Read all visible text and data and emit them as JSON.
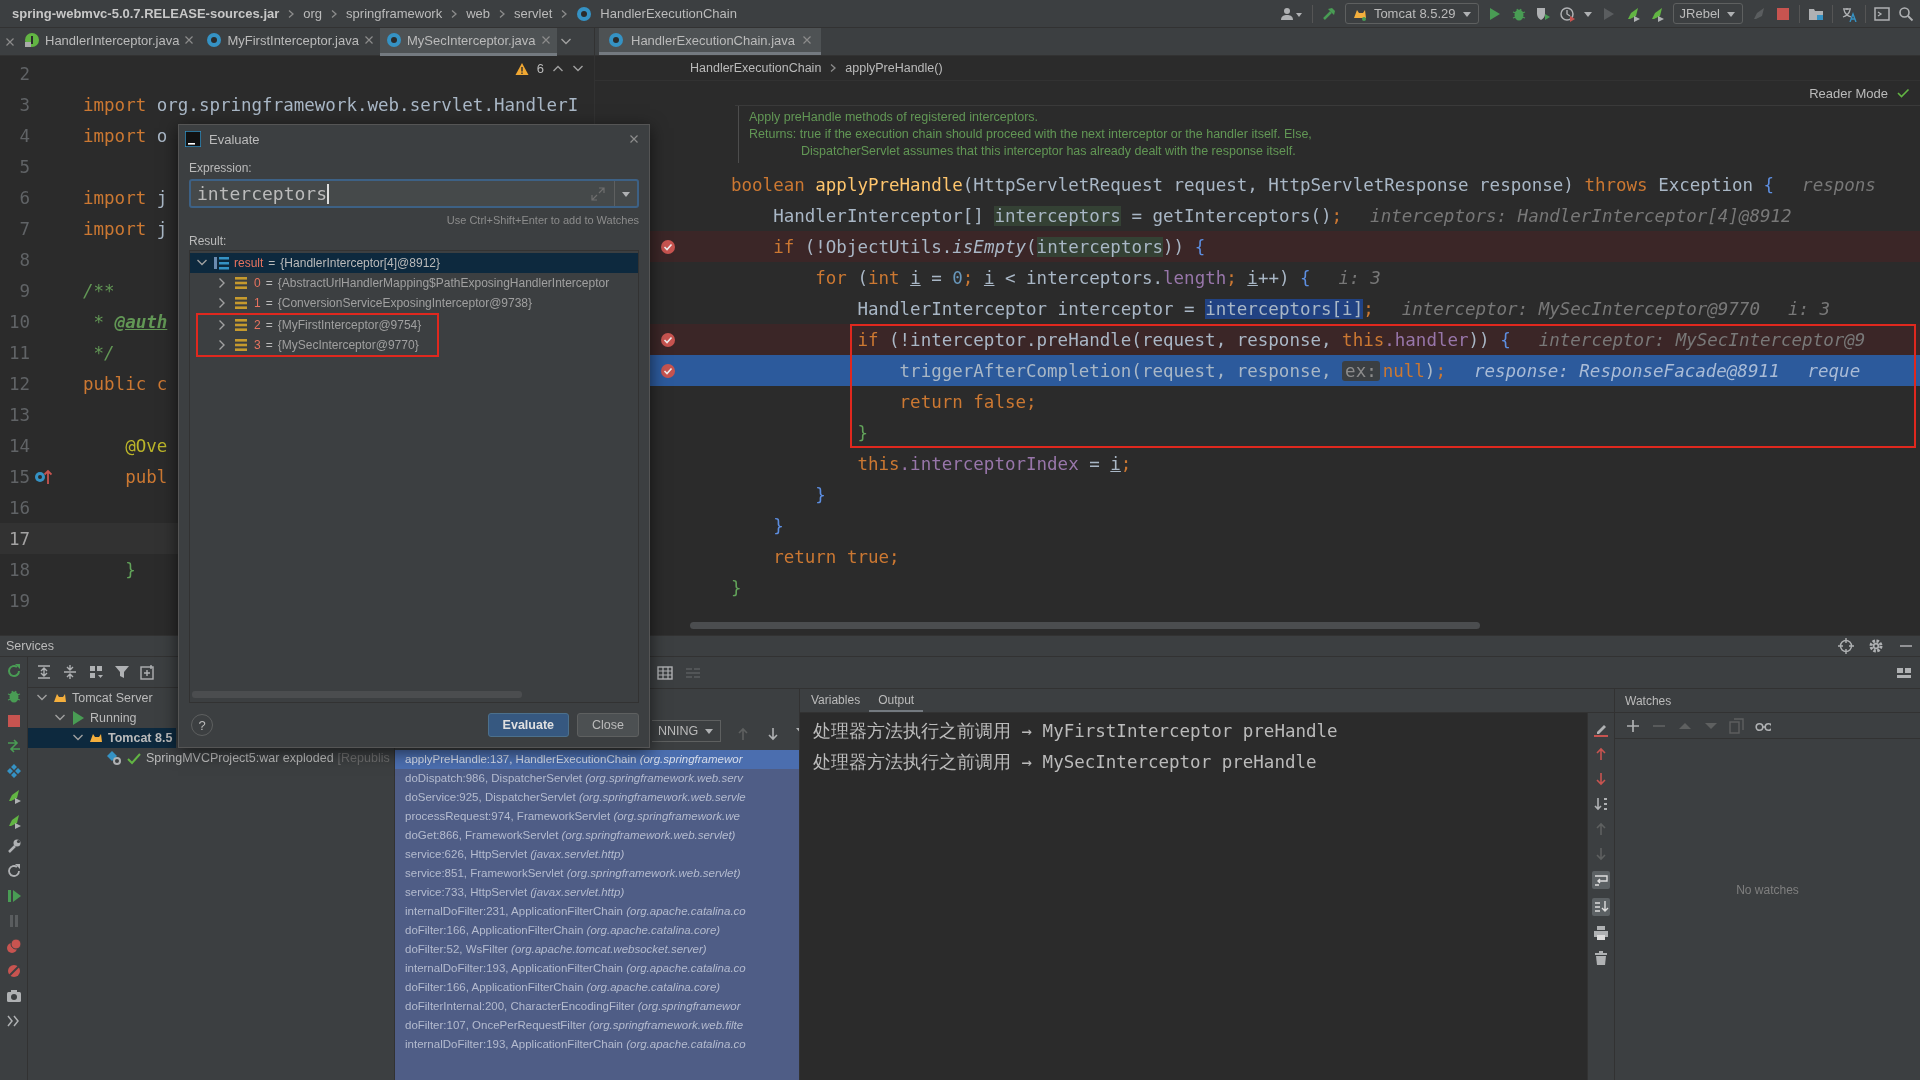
{
  "navbar": {
    "crumbs": [
      {
        "text": "spring-webmvc-5.0.7.RELEASE-sources.jar",
        "kind": "jar"
      },
      {
        "text": "org",
        "kind": "package"
      },
      {
        "text": "springframework",
        "kind": "package"
      },
      {
        "text": "web",
        "kind": "package"
      },
      {
        "text": "servlet",
        "kind": "package"
      },
      {
        "text": "HandlerExecutionChain",
        "kind": "class"
      }
    ],
    "run_config": "Tomcat 8.5.29",
    "plugin": "JRebel"
  },
  "left_editor": {
    "tabs": [
      {
        "label": "HandlerInterceptor.java",
        "kind": "interface",
        "selected": false
      },
      {
        "label": "MyFirstInterceptor.java",
        "kind": "class",
        "selected": false
      },
      {
        "label": "MySecInterceptor.java",
        "kind": "class",
        "selected": true
      }
    ],
    "warnings": "6",
    "lines": [
      {
        "number": "2",
        "kind": "plain",
        "current": false
      },
      {
        "number": "3",
        "kind": "plain",
        "current": false,
        "tokens": [
          {
            "kind": "kw",
            "text": "import "
          },
          {
            "kind": "plain",
            "text": "org.springframework.web.servlet.HandlerI"
          }
        ]
      },
      {
        "number": "4",
        "kind": "plain",
        "current": false,
        "tokens": [
          {
            "kind": "kw",
            "text": "import "
          },
          {
            "kind": "plain",
            "text": "o"
          }
        ]
      },
      {
        "number": "5",
        "kind": "plain",
        "current": false
      },
      {
        "number": "6",
        "kind": "plain",
        "current": false,
        "tokens": [
          {
            "kind": "kw",
            "text": "import "
          },
          {
            "kind": "plain",
            "text": "j"
          }
        ]
      },
      {
        "number": "7",
        "kind": "plain",
        "current": false,
        "tokens": [
          {
            "kind": "kw",
            "text": "import "
          },
          {
            "kind": "plain",
            "text": "j"
          }
        ]
      },
      {
        "number": "8",
        "kind": "plain",
        "current": false
      },
      {
        "number": "9",
        "kind": "plain",
        "current": false,
        "tokens": [
          {
            "kind": "comment",
            "text": "/**"
          }
        ]
      },
      {
        "number": "10",
        "kind": "plain",
        "current": false,
        "tokens": [
          {
            "kind": "comment",
            "text": " * "
          },
          {
            "kind": "doctag",
            "text": "@auth"
          }
        ]
      },
      {
        "number": "11",
        "kind": "plain",
        "current": false,
        "tokens": [
          {
            "kind": "comment",
            "text": " */"
          }
        ]
      },
      {
        "number": "12",
        "kind": "plain",
        "current": false,
        "tokens": [
          {
            "kind": "kw",
            "text": "public c"
          }
        ]
      },
      {
        "number": "13",
        "kind": "plain",
        "current": false
      },
      {
        "number": "14",
        "kind": "plain",
        "current": false,
        "tokens": [
          {
            "kind": "annot",
            "text": "    @Ove"
          }
        ]
      },
      {
        "number": "15",
        "kind": "override",
        "current": false,
        "tokens": [
          {
            "kind": "kw",
            "text": "    publ"
          }
        ]
      },
      {
        "number": "16",
        "kind": "plain",
        "current": false
      },
      {
        "number": "17",
        "kind": "plain",
        "current": true
      },
      {
        "number": "18",
        "kind": "plain",
        "current": false,
        "tokens": [
          {
            "kind": "brace2",
            "text": "    }"
          }
        ]
      },
      {
        "number": "19",
        "kind": "plain",
        "current": false
      }
    ]
  },
  "right_editor": {
    "tabs": [
      {
        "label": "HandlerExecutionChain.java",
        "kind": "class",
        "selected": true
      }
    ],
    "breadcrumb": [
      "HandlerExecutionChain",
      "applyPreHandle()"
    ],
    "reader_mode": "Reader Mode",
    "doc": [
      {
        "kind": "summary",
        "text": "Apply preHandle methods of registered interceptors."
      },
      {
        "kind": "returns",
        "text": "Returns: true if the execution chain should proceed with the next interceptor or the handler itself. Else,"
      },
      {
        "kind": "continuation",
        "text": "DispatcherServlet assumes that this interceptor has already dealt with the response itself."
      }
    ],
    "lines": [
      {
        "breakpoint": false,
        "current": false,
        "boxed": false,
        "hints": [
          "respons"
        ],
        "tokens": [
          {
            "kind": "kw",
            "text": "boolean "
          },
          {
            "kind": "fn",
            "text": "applyPreHandle"
          },
          {
            "kind": "plain",
            "text": "(HttpServletRequest request, HttpServletResponse response) "
          },
          {
            "kind": "kw",
            "text": "throws "
          },
          {
            "kind": "plain",
            "text": "Exception "
          },
          {
            "kind": "brace",
            "text": "{"
          }
        ]
      },
      {
        "breakpoint": false,
        "current": false,
        "boxed": false,
        "hints": [
          "interceptors: HandlerInterceptor[4]@8912"
        ],
        "tokens": [
          {
            "kind": "plain",
            "text": "    HandlerInterceptor[] "
          },
          {
            "kind": "usage",
            "text": "interceptors"
          },
          {
            "kind": "plain",
            "text": " = getInterceptors()"
          },
          {
            "kind": "kw",
            "text": ";"
          }
        ]
      },
      {
        "breakpoint": true,
        "current": false,
        "boxed": false,
        "tokens": [
          {
            "kind": "kw",
            "text": "    if "
          },
          {
            "kind": "plain",
            "text": "(!ObjectUtils."
          },
          {
            "kind": "static",
            "text": "isEmpty"
          },
          {
            "kind": "plain",
            "text": "("
          },
          {
            "kind": "usage",
            "text": "interceptors"
          },
          {
            "kind": "plain",
            "text": ")) "
          },
          {
            "kind": "brace",
            "text": "{"
          }
        ]
      },
      {
        "breakpoint": false,
        "current": false,
        "boxed": false,
        "hints": [
          "i: 3"
        ],
        "tokens": [
          {
            "kind": "kw",
            "text": "        for "
          },
          {
            "kind": "plain",
            "text": "("
          },
          {
            "kind": "kw",
            "text": "int "
          },
          {
            "kind": "var",
            "text": "i"
          },
          {
            "kind": "plain",
            "text": " = "
          },
          {
            "kind": "num",
            "text": "0"
          },
          {
            "kind": "kw",
            "text": "; "
          },
          {
            "kind": "var",
            "text": "i"
          },
          {
            "kind": "plain",
            "text": " < interceptors."
          },
          {
            "kind": "field",
            "text": "length"
          },
          {
            "kind": "kw",
            "text": "; "
          },
          {
            "kind": "var",
            "text": "i"
          },
          {
            "kind": "plain",
            "text": "++) "
          },
          {
            "kind": "brace",
            "text": "{"
          }
        ]
      },
      {
        "breakpoint": false,
        "current": false,
        "boxed": false,
        "hints": [
          "interceptor: MySecInterceptor@9770",
          "i: 3"
        ],
        "tokens": [
          {
            "kind": "plain",
            "text": "            HandlerInterceptor interceptor = "
          },
          {
            "kind": "sel",
            "text": "interceptors[i]"
          },
          {
            "kind": "kw",
            "text": ";"
          }
        ]
      },
      {
        "breakpoint": true,
        "current": false,
        "boxed": true,
        "hints": [
          "interceptor: MySecInterceptor@9"
        ],
        "tokens": [
          {
            "kind": "kw",
            "text": "            if "
          },
          {
            "kind": "plain",
            "text": "(!interceptor.preHandle(request, response, "
          },
          {
            "kind": "kw",
            "text": "this"
          },
          {
            "kind": "field",
            "text": ".handler"
          },
          {
            "kind": "plain",
            "text": ")) "
          },
          {
            "kind": "brace",
            "text": "{"
          }
        ]
      },
      {
        "breakpoint": true,
        "current": true,
        "boxed": true,
        "hints": [
          "response: ResponseFacade@8911",
          "reque"
        ],
        "tokens": [
          {
            "kind": "plain",
            "text": "                triggerAfterCompletion(request, response, "
          },
          {
            "kind": "param",
            "text": "ex:"
          },
          {
            "kind": "kw",
            "text": "null"
          },
          {
            "kind": "plain",
            "text": ")"
          },
          {
            "kind": "kw",
            "text": ";"
          }
        ]
      },
      {
        "breakpoint": false,
        "current": false,
        "boxed": true,
        "tokens": [
          {
            "kind": "kw",
            "text": "                return false;"
          }
        ]
      },
      {
        "breakpoint": false,
        "current": false,
        "boxed": true,
        "tokens": [
          {
            "kind": "brace2",
            "text": "            }"
          }
        ]
      },
      {
        "breakpoint": false,
        "current": false,
        "boxed": false,
        "tokens": [
          {
            "kind": "kw",
            "text": "            this"
          },
          {
            "kind": "field",
            "text": ".interceptorIndex"
          },
          {
            "kind": "plain",
            "text": " = "
          },
          {
            "kind": "var",
            "text": "i"
          },
          {
            "kind": "kw",
            "text": ";"
          }
        ]
      },
      {
        "breakpoint": false,
        "current": false,
        "boxed": false,
        "tokens": [
          {
            "kind": "brace",
            "text": "        }"
          }
        ]
      },
      {
        "breakpoint": false,
        "current": false,
        "boxed": false,
        "tokens": [
          {
            "kind": "brace",
            "text": "    }"
          }
        ]
      },
      {
        "breakpoint": false,
        "current": false,
        "boxed": false,
        "tokens": [
          {
            "kind": "kw",
            "text": "    return true;"
          }
        ]
      },
      {
        "breakpoint": false,
        "current": false,
        "boxed": false,
        "tokens": [
          {
            "kind": "brace2",
            "text": "}"
          }
        ]
      }
    ]
  },
  "evaluate_dialog": {
    "title": "Evaluate",
    "expression_label": "Expression:",
    "expression": "interceptors",
    "hint": "Use Ctrl+Shift+Enter to add to Watches",
    "result_label": "Result:",
    "result": {
      "name": "result",
      "operator": "=",
      "value": "{HandlerInterceptor[4]@8912}",
      "kind": "array",
      "expanded": true,
      "selected": true,
      "boxed": false,
      "children": [
        {
          "name": "0",
          "operator": "=",
          "value": "{AbstractUrlHandlerMapping$PathExposingHandlerInterceptor",
          "kind": "object",
          "expanded": false,
          "selected": false,
          "boxed": false
        },
        {
          "name": "1",
          "operator": "=",
          "value": "{ConversionServiceExposingInterceptor@9738}",
          "kind": "object",
          "expanded": false,
          "selected": false,
          "boxed": false
        },
        {
          "name": "2",
          "operator": "=",
          "value": "{MyFirstInterceptor@9754}",
          "kind": "object",
          "expanded": false,
          "selected": false,
          "boxed": true
        },
        {
          "name": "3",
          "operator": "=",
          "value": "{MySecInterceptor@9770}",
          "kind": "object",
          "expanded": false,
          "selected": false,
          "boxed": true
        }
      ]
    },
    "help": "?",
    "buttons": [
      {
        "label": "Evaluate",
        "kind": "default"
      },
      {
        "label": "Close",
        "kind": "normal"
      }
    ]
  },
  "services": {
    "title": "Services",
    "tree": [
      {
        "label": "Tomcat Server",
        "kind": "server",
        "expanded": true,
        "selected": false,
        "children": [
          {
            "label": "Running",
            "kind": "running",
            "expanded": true,
            "selected": false,
            "children": [
              {
                "label": "Tomcat 8.5",
                "kind": "tomcat",
                "expanded": true,
                "selected": true,
                "children": [
                  {
                    "label": "SpringMVCProject5:war exploded",
                    "status": "[Republis",
                    "kind": "artifact",
                    "selected": false
                  }
                ]
              }
            ]
          }
        ]
      }
    ]
  },
  "debugger": {
    "thread": "NNING",
    "frames": [
      {
        "method": "applyPreHandle:137, HandlerExecutionChain",
        "package": "(org.springframewor",
        "selected": true
      },
      {
        "method": "doDispatch:986, DispatcherServlet",
        "package": "(org.springframework.web.serv",
        "selected": false
      },
      {
        "method": "doService:925, DispatcherServlet",
        "package": "(org.springframework.web.servle",
        "selected": false
      },
      {
        "method": "processRequest:974, FrameworkServlet",
        "package": "(org.springframework.we",
        "selected": false
      },
      {
        "method": "doGet:866, FrameworkServlet",
        "package": "(org.springframework.web.servlet)",
        "selected": false
      },
      {
        "method": "service:626, HttpServlet",
        "package": "(javax.servlet.http)",
        "selected": false
      },
      {
        "method": "service:851, FrameworkServlet",
        "package": "(org.springframework.web.servlet)",
        "selected": false
      },
      {
        "method": "service:733, HttpServlet",
        "package": "(javax.servlet.http)",
        "selected": false
      },
      {
        "method": "internalDoFilter:231, ApplicationFilterChain",
        "package": "(org.apache.catalina.co",
        "selected": false
      },
      {
        "method": "doFilter:166, ApplicationFilterChain",
        "package": "(org.apache.catalina.core)",
        "selected": false
      },
      {
        "method": "doFilter:52, WsFilter",
        "package": "(org.apache.tomcat.websocket.server)",
        "selected": false
      },
      {
        "method": "internalDoFilter:193, ApplicationFilterChain",
        "package": "(org.apache.catalina.co",
        "selected": false
      },
      {
        "method": "doFilter:166, ApplicationFilterChain",
        "package": "(org.apache.catalina.core)",
        "selected": false
      },
      {
        "method": "doFilterInternal:200, CharacterEncodingFilter",
        "package": "(org.springframewor",
        "selected": false
      },
      {
        "method": "doFilter:107, OncePerRequestFilter",
        "package": "(org.springframework.web.filte",
        "selected": false
      },
      {
        "method": "internalDoFilter:193, ApplicationFilterChain",
        "package": "(org.apache.catalina.co",
        "selected": false
      }
    ],
    "tabs": [
      {
        "label": "Variables",
        "selected": false
      },
      {
        "label": "Output",
        "selected": true
      }
    ],
    "output": [
      "处理器方法执行之前调用 → MyFirstInterceptor preHandle",
      "处理器方法执行之前调用 → MySecInterceptor preHandle"
    ],
    "watches": {
      "title": "Watches",
      "empty": "No watches"
    }
  }
}
